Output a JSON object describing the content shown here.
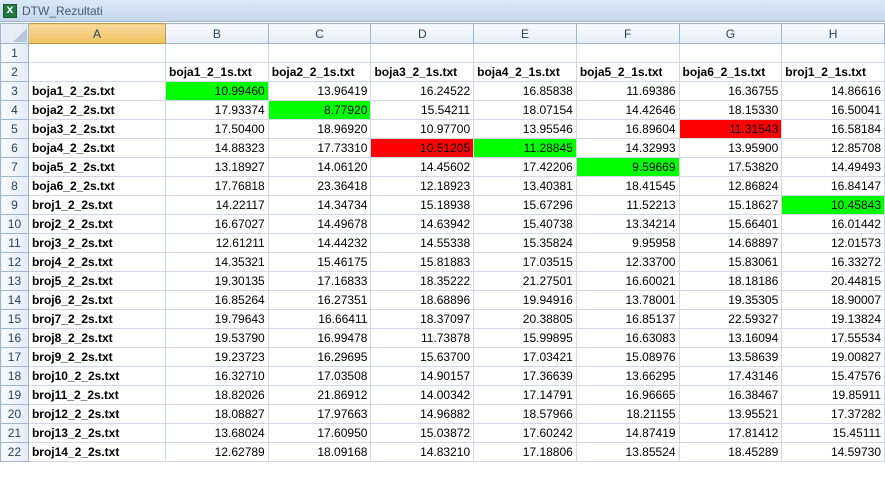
{
  "window": {
    "title": "DTW_Rezultati",
    "icon": "excel-icon",
    "icon_glyph": "X"
  },
  "colors": {
    "match_green": "#00ff00",
    "mismatch_red": "#ff0000"
  },
  "columns": [
    "A",
    "B",
    "C",
    "D",
    "E",
    "F",
    "G",
    "H"
  ],
  "header_row": [
    "",
    "boja1_2_1s.txt",
    "boja2_2_1s.txt",
    "boja3_2_1s.txt",
    "boja4_2_1s.txt",
    "boja5_2_1s.txt",
    "boja6_2_1s.txt",
    "broj1_2_1s.txt"
  ],
  "rows": [
    {
      "num": "1",
      "label": "",
      "values": [
        "",
        "",
        "",
        "",
        "",
        "",
        ""
      ]
    },
    {
      "num": "2",
      "label": "",
      "values": [
        "boja1_2_1s.txt",
        "boja2_2_1s.txt",
        "boja3_2_1s.txt",
        "boja4_2_1s.txt",
        "boja5_2_1s.txt",
        "boja6_2_1s.txt",
        "broj1_2_1s.txt"
      ]
    },
    {
      "num": "3",
      "label": "boja1_2_2s.txt",
      "values": [
        "10.99460",
        "13.96419",
        "16.24522",
        "16.85838",
        "11.69386",
        "16.36755",
        "14.86616"
      ]
    },
    {
      "num": "4",
      "label": "boja2_2_2s.txt",
      "values": [
        "17.93374",
        "8.77920",
        "15.54211",
        "18.07154",
        "14.42646",
        "18.15330",
        "16.50041"
      ]
    },
    {
      "num": "5",
      "label": "boja3_2_2s.txt",
      "values": [
        "17.50400",
        "18.96920",
        "10.97700",
        "13.95546",
        "16.89604",
        "11.31543",
        "16.58184"
      ]
    },
    {
      "num": "6",
      "label": "boja4_2_2s.txt",
      "values": [
        "14.88323",
        "17.73310",
        "10.51205",
        "11.28845",
        "14.32993",
        "13.95900",
        "12.85708"
      ]
    },
    {
      "num": "7",
      "label": "boja5_2_2s.txt",
      "values": [
        "13.18927",
        "14.06120",
        "14.45602",
        "17.42206",
        "9.59669",
        "17.53820",
        "14.49493"
      ]
    },
    {
      "num": "8",
      "label": "boja6_2_2s.txt",
      "values": [
        "17.76818",
        "23.36418",
        "12.18923",
        "13.40381",
        "18.41545",
        "12.86824",
        "16.84147"
      ]
    },
    {
      "num": "9",
      "label": "broj1_2_2s.txt",
      "values": [
        "14.22117",
        "14.34734",
        "15.18938",
        "15.67296",
        "11.52213",
        "15.18627",
        "10.45843"
      ]
    },
    {
      "num": "10",
      "label": "broj2_2_2s.txt",
      "values": [
        "16.67027",
        "14.49678",
        "14.63942",
        "15.40738",
        "13.34214",
        "15.66401",
        "16.01442"
      ]
    },
    {
      "num": "11",
      "label": "broj3_2_2s.txt",
      "values": [
        "12.61211",
        "14.44232",
        "14.55338",
        "15.35824",
        "9.95958",
        "14.68897",
        "12.01573"
      ]
    },
    {
      "num": "12",
      "label": "broj4_2_2s.txt",
      "values": [
        "14.35321",
        "15.46175",
        "15.81883",
        "17.03515",
        "12.33700",
        "15.83061",
        "16.33272"
      ]
    },
    {
      "num": "13",
      "label": "broj5_2_2s.txt",
      "values": [
        "19.30135",
        "17.16833",
        "18.35222",
        "21.27501",
        "16.60021",
        "18.18186",
        "20.44815"
      ]
    },
    {
      "num": "14",
      "label": "broj6_2_2s.txt",
      "values": [
        "16.85264",
        "16.27351",
        "18.68896",
        "19.94916",
        "13.78001",
        "19.35305",
        "18.90007"
      ]
    },
    {
      "num": "15",
      "label": "broj7_2_2s.txt",
      "values": [
        "19.79643",
        "16.66411",
        "18.37097",
        "20.38805",
        "16.85137",
        "22.59327",
        "19.13824"
      ]
    },
    {
      "num": "16",
      "label": "broj8_2_2s.txt",
      "values": [
        "19.53790",
        "16.99478",
        "11.73878",
        "15.99895",
        "16.63083",
        "13.16094",
        "17.55534"
      ]
    },
    {
      "num": "17",
      "label": "broj9_2_2s.txt",
      "values": [
        "19.23723",
        "16.29695",
        "15.63700",
        "17.03421",
        "15.08976",
        "13.58639",
        "19.00827"
      ]
    },
    {
      "num": "18",
      "label": "broj10_2_2s.txt",
      "values": [
        "16.32710",
        "17.03508",
        "14.90157",
        "17.36639",
        "13.66295",
        "17.43146",
        "15.47576"
      ]
    },
    {
      "num": "19",
      "label": "broj11_2_2s.txt",
      "values": [
        "18.82026",
        "21.86912",
        "14.00342",
        "17.14791",
        "16.96665",
        "16.38467",
        "19.85911"
      ]
    },
    {
      "num": "20",
      "label": "broj12_2_2s.txt",
      "values": [
        "18.08827",
        "17.97663",
        "14.96882",
        "18.57966",
        "18.21155",
        "13.95521",
        "17.37282"
      ]
    },
    {
      "num": "21",
      "label": "broj13_2_2s.txt",
      "values": [
        "13.68024",
        "17.60950",
        "15.03872",
        "17.60242",
        "14.87419",
        "17.81412",
        "15.45111"
      ]
    },
    {
      "num": "22",
      "label": "broj14_2_2s.txt",
      "values": [
        "12.62789",
        "18.09168",
        "14.83210",
        "17.18806",
        "13.85524",
        "18.45289",
        "14.59730"
      ]
    }
  ],
  "highlights": {
    "green": [
      "3:0",
      "4:1",
      "6:3",
      "7:4",
      "9:6"
    ],
    "red": [
      "5:5",
      "6:2"
    ]
  }
}
